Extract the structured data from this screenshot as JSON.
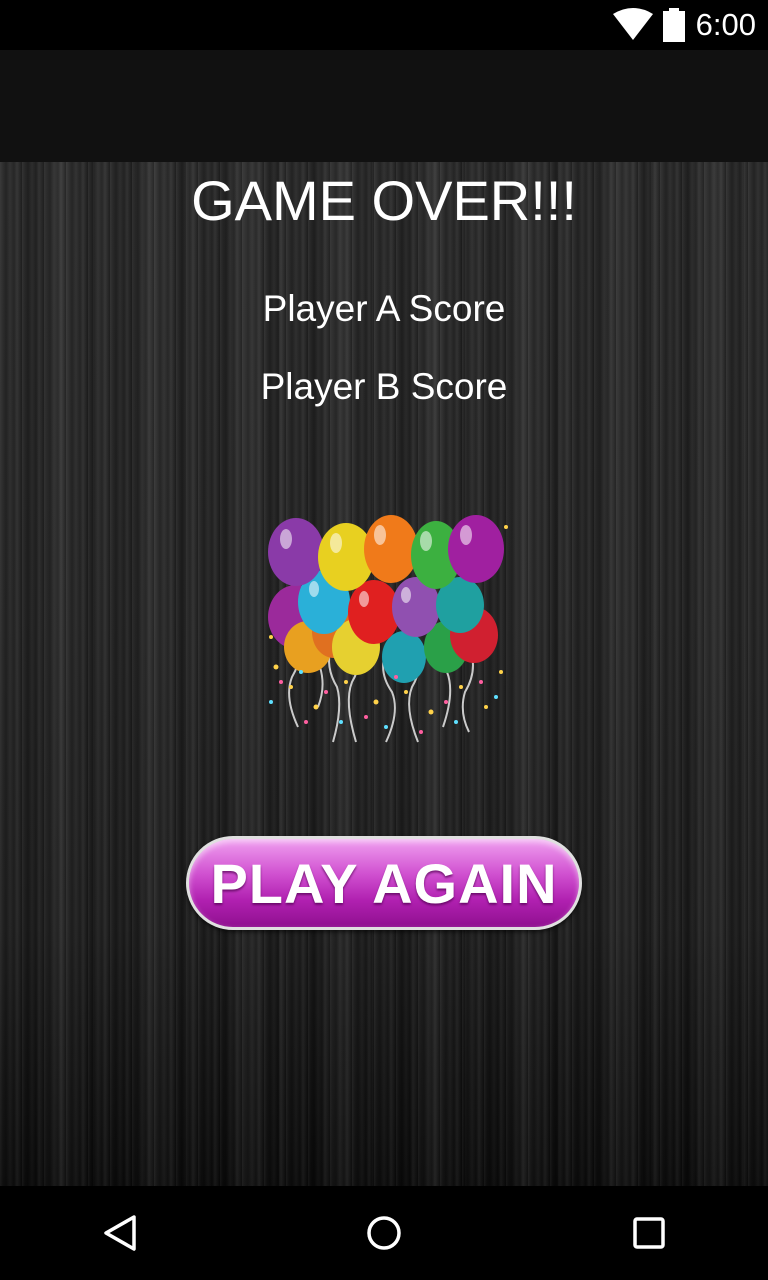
{
  "status_bar": {
    "time": "6:00",
    "icons": [
      "wifi-icon",
      "battery-icon"
    ]
  },
  "main": {
    "title": "GAME OVER!!!",
    "player_a_label": "Player A Score",
    "player_b_label": "Player B Score",
    "image": "balloons-celebration",
    "play_again_label": "PLAY AGAIN"
  },
  "nav_bar": {
    "icons": [
      "back-icon",
      "home-icon",
      "recents-icon"
    ]
  },
  "colors": {
    "button_top": "#f0a0f0",
    "button_bottom": "#901090",
    "text": "#ffffff",
    "background": "#262626"
  }
}
